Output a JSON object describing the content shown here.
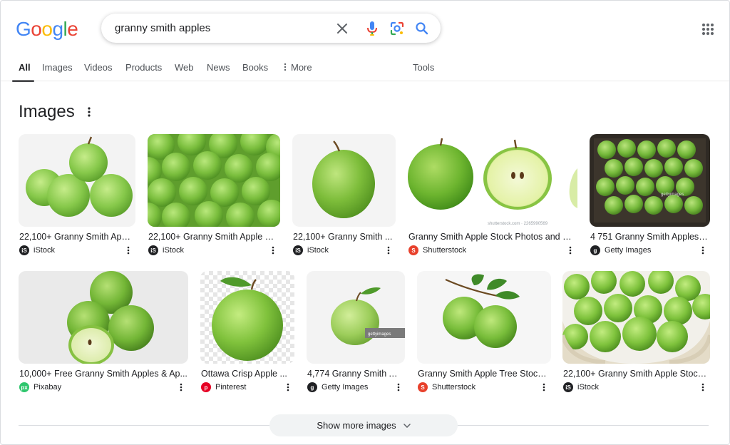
{
  "header": {
    "logo": {
      "letters": [
        "G",
        "o",
        "o",
        "g",
        "l",
        "e"
      ],
      "colors": [
        "#4285F4",
        "#EA4335",
        "#FBBC05",
        "#4285F4",
        "#34A853",
        "#EA4335"
      ]
    },
    "search": {
      "query": "granny smith apples"
    },
    "icons": {
      "clear": "close-icon",
      "voice": "microphone-icon",
      "lens": "camera-lens-icon",
      "search": "search-icon",
      "apps": "apps-grid-icon"
    }
  },
  "tabs": [
    {
      "label": "All",
      "active": true
    },
    {
      "label": "Images"
    },
    {
      "label": "Videos"
    },
    {
      "label": "Products"
    },
    {
      "label": "Web"
    },
    {
      "label": "News"
    },
    {
      "label": "Books"
    },
    {
      "label": "More"
    },
    {
      "label": "Tools"
    }
  ],
  "section": {
    "title": "Images"
  },
  "results": [
    {
      "title": "22,100+ Granny Smith Appl...",
      "source": "iStock",
      "favicon": "iS",
      "favicon_color": "#202124"
    },
    {
      "title": "22,100+ Granny Smith Apple St...",
      "source": "iStock",
      "favicon": "iS",
      "favicon_color": "#202124"
    },
    {
      "title": "22,100+ Granny Smith ...",
      "source": "iStock",
      "favicon": "iS",
      "favicon_color": "#202124"
    },
    {
      "title": "Granny Smith Apple Stock Photos and Pi...",
      "source": "Shutterstock",
      "favicon": "S",
      "favicon_color": "#e8412c"
    },
    {
      "title": "4 751 Granny Smith Apples ...",
      "source": "Getty Images",
      "favicon": "g",
      "favicon_color": "#202124"
    },
    {
      "title": "10,000+ Free Granny Smith Apples & Ap...",
      "source": "Pixabay",
      "favicon": "px",
      "favicon_color": "#2ec66d"
    },
    {
      "title": "Ottawa Crisp Apple ...",
      "source": "Pinterest",
      "favicon": "p",
      "favicon_color": "#e60023"
    },
    {
      "title": "4,774 Granny Smith A...",
      "source": "Getty Images",
      "favicon": "g",
      "favicon_color": "#202124"
    },
    {
      "title": "Granny Smith Apple Tree Stock ...",
      "source": "Shutterstock",
      "favicon": "S",
      "favicon_color": "#e8412c"
    },
    {
      "title": "22,100+ Granny Smith Apple Stock ...",
      "source": "iStock",
      "favicon": "iS",
      "favicon_color": "#202124"
    }
  ],
  "watermarks": {
    "shutterstock": "shutterstock.com · 2265990569",
    "getty": "gettyimages"
  },
  "show_more": {
    "label": "Show more images"
  },
  "colors": {
    "apple_green": "#7cc23a",
    "apple_dark": "#4f9a1c",
    "leaf": "#3f7f2a"
  }
}
